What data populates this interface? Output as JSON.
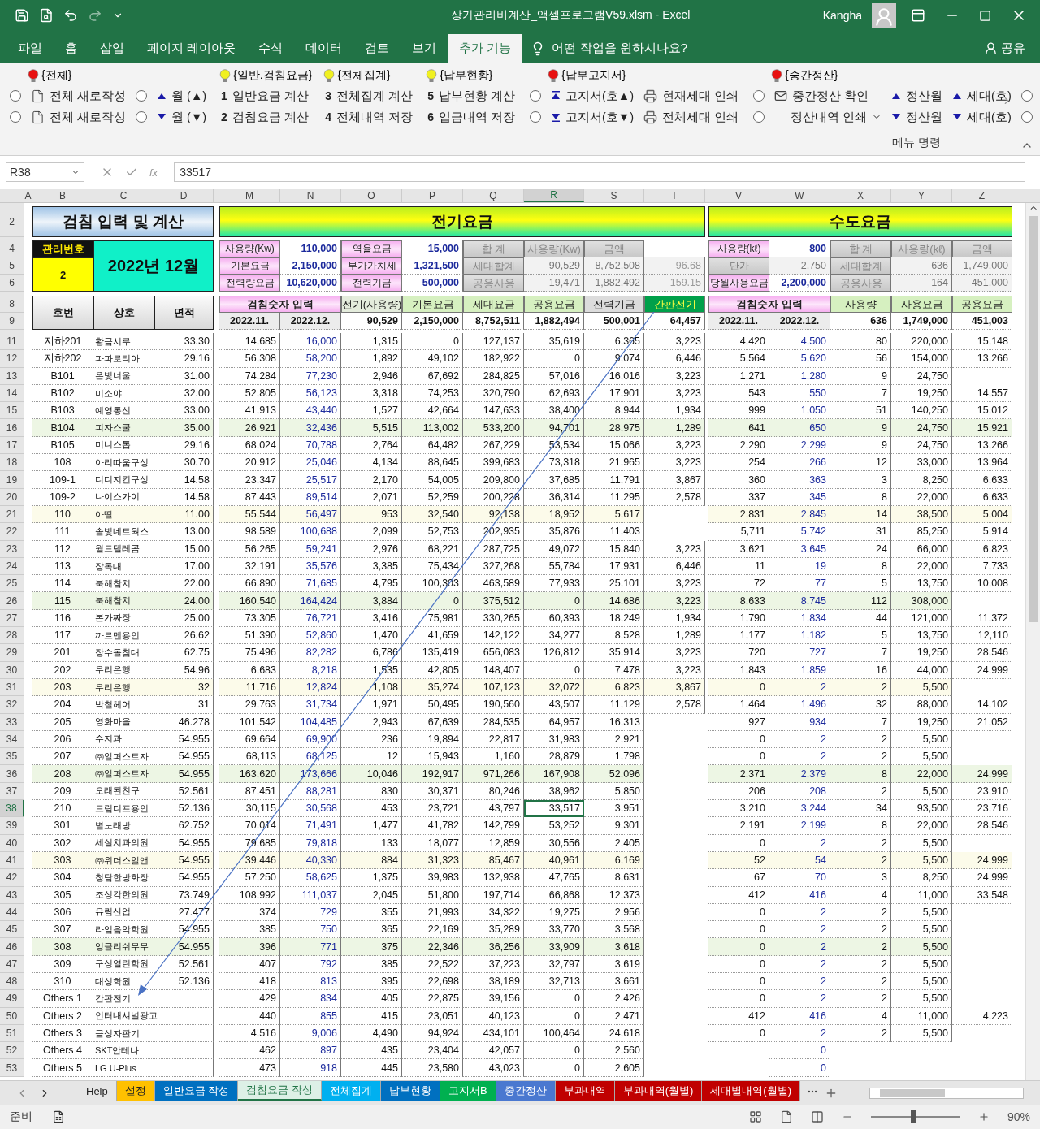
{
  "title_bar": {
    "title": "상가관리비계산_액셀프로그램V59.xlsm  -  Excel",
    "user": "Kangha"
  },
  "menu_tabs": [
    {
      "label": "파일",
      "selected": false
    },
    {
      "label": "홈",
      "selected": false
    },
    {
      "label": "삽입",
      "selected": false
    },
    {
      "label": "페이지 레이아웃",
      "selected": false
    },
    {
      "label": "수식",
      "selected": false
    },
    {
      "label": "데이터",
      "selected": false
    },
    {
      "label": "검토",
      "selected": false
    },
    {
      "label": "보기",
      "selected": false
    },
    {
      "label": "추가 기능",
      "selected": true
    }
  ],
  "tell_me": "어떤 작업을 원하시나요?",
  "share": "공유",
  "ribbon": {
    "groups": [
      {
        "header": {
          "label": "{전체}",
          "color": "#e81010"
        },
        "columns": [
          [
            {
              "kind": "radio",
              "selected": false
            },
            {
              "kind": "radio",
              "selected": false
            }
          ],
          [
            {
              "kind": "doc",
              "label": "전체 새로작성"
            },
            {
              "kind": "doc",
              "label": "전체 새로작성"
            }
          ],
          [
            {
              "kind": "radio",
              "selected": false
            },
            {
              "kind": "radio",
              "selected": false
            }
          ],
          [
            {
              "kind": "up",
              "label": "월 (▲)"
            },
            {
              "kind": "down",
              "label": "월 (▼)"
            }
          ]
        ]
      },
      {
        "header": {
          "label": "{일반.검침요금}",
          "color": "#f0f020"
        },
        "columns": [
          [
            {
              "kind": "num",
              "number": "1",
              "label": "일반요금 계산"
            },
            {
              "kind": "num",
              "number": "2",
              "label": "검침요금 계산"
            }
          ]
        ]
      },
      {
        "header": {
          "label": "{전체집계}",
          "color": "#f0f020"
        },
        "columns": [
          [
            {
              "kind": "num",
              "number": "3",
              "label": "전체집계 계산"
            },
            {
              "kind": "num",
              "number": "4",
              "label": "전체내역 저장"
            }
          ]
        ]
      },
      {
        "header": {
          "label": "{납부현황}",
          "color": "#f0f020"
        },
        "columns": [
          [
            {
              "kind": "num",
              "number": "5",
              "label": "납부현황 계산"
            },
            {
              "kind": "num",
              "number": "6",
              "label": "입금내역 저장"
            }
          ]
        ]
      },
      {
        "header": {
          "label": "{납부고지서}",
          "color": "#e81010"
        },
        "columns": [
          [
            {
              "kind": "radio",
              "selected": false
            },
            {
              "kind": "radio",
              "selected": false
            }
          ],
          [
            {
              "kind": "top",
              "label": "고지서(호▲)"
            },
            {
              "kind": "bottom",
              "label": "고지서(호▼)"
            }
          ],
          [
            {
              "kind": "print",
              "label": "현재세대 인쇄"
            },
            {
              "kind": "print",
              "label": "전체세대 인쇄"
            }
          ]
        ]
      },
      {
        "header": {
          "label": "{중간정산}",
          "color": "#e81010"
        },
        "columns": [
          [
            {
              "kind": "radio",
              "selected": false
            },
            {
              "kind": "radio",
              "selected": false
            }
          ],
          [
            {
              "kind": "mail",
              "label": "중간정산 확인"
            },
            {
              "kind": "dropdown",
              "label": "정산내역 인쇄"
            }
          ],
          [
            {
              "kind": "up",
              "label": "정산월"
            },
            {
              "kind": "down",
              "label": "정산월"
            }
          ],
          [
            {
              "kind": "up",
              "label": "세대(호)"
            },
            {
              "kind": "down",
              "label": "세대(호)"
            }
          ],
          [
            {
              "kind": "radio",
              "selected": false
            },
            {
              "kind": "radio",
              "selected": false
            }
          ]
        ]
      }
    ],
    "caption": "메뉴 명령"
  },
  "formula_bar": {
    "name_box": "R38",
    "function_label": "fx",
    "formula": "33517"
  },
  "columns": [
    {
      "label": "A",
      "selected": false
    },
    {
      "label": "B",
      "selected": false
    },
    {
      "label": "C",
      "selected": false
    },
    {
      "label": "D",
      "selected": false
    },
    {
      "label": "M",
      "selected": false
    },
    {
      "label": "N",
      "selected": false
    },
    {
      "label": "O",
      "selected": false
    },
    {
      "label": "P",
      "selected": false
    },
    {
      "label": "Q",
      "selected": false
    },
    {
      "label": "R",
      "selected": true
    },
    {
      "label": "S",
      "selected": false
    },
    {
      "label": "T",
      "selected": false
    },
    {
      "label": "V",
      "selected": false
    },
    {
      "label": "W",
      "selected": false
    },
    {
      "label": "X",
      "selected": false
    },
    {
      "label": "Y",
      "selected": false
    },
    {
      "label": "Z",
      "selected": false
    }
  ],
  "header_rows": [
    "2",
    "4",
    "5",
    "6",
    "8",
    "9"
  ],
  "left_panel": {
    "title": "검침 입력 및 계산",
    "mgmt_label": "관리번호",
    "mgmt_no": "2",
    "period": "2022년 12월",
    "columns": [
      "호번",
      "상호",
      "면적"
    ]
  },
  "electric": {
    "title": "전기요금",
    "inputs": [
      {
        "label": "사용량(Kw)",
        "value": "110,000",
        "kind": "input"
      },
      {
        "label": "기본요금",
        "value": "2,150,000",
        "kind": "input"
      },
      {
        "label": "전력량요금",
        "value": "10,620,000",
        "kind": "input"
      }
    ],
    "inputs2": [
      {
        "label": "역율요금",
        "value": "15,000",
        "kind": "input"
      },
      {
        "label": "부가가치세",
        "value": "1,321,500",
        "kind": "input"
      },
      {
        "label": "전력기금",
        "value": "500,000",
        "kind": "input"
      }
    ],
    "summary_headers": [
      "합  계",
      "사용량(Kw)",
      "금액"
    ],
    "summary_rows": [
      {
        "label": "세대합계",
        "usage": "90,529",
        "amount": "8,752,508",
        "ratio": "96.68"
      },
      {
        "label": "공용사용",
        "usage": "19,471",
        "amount": "1,882,492",
        "ratio": "159.15"
      }
    ],
    "reading_header": "검침숫자 입력",
    "months": [
      "2022.11.",
      "2022.12."
    ],
    "columns": [
      {
        "label": "전기(사용량)",
        "color": "#e4ecdc"
      },
      {
        "label": "기본요금",
        "color": "#d6f0c0"
      },
      {
        "label": "세대요금",
        "color": "#d6f0c0"
      },
      {
        "label": "공용요금",
        "color": "#d6f0c0"
      },
      {
        "label": "전력기금",
        "color": "#dcdcdc"
      },
      {
        "label": "간판전기",
        "color": "#00a04a"
      }
    ],
    "totals": [
      "90,529",
      "2,150,000",
      "8,752,511",
      "1,882,494",
      "500,001",
      "64,457"
    ]
  },
  "water": {
    "title": "수도요금",
    "inputs": [
      {
        "label": "사용량(kℓ)",
        "value": "800",
        "kind": "input"
      },
      {
        "label": "단가",
        "value": "2,750",
        "kind": "computed"
      },
      {
        "label": "당월사용요금",
        "value": "2,200,000",
        "kind": "input"
      }
    ],
    "summary_headers": [
      "합  계",
      "사용량(kℓ)",
      "금액"
    ],
    "summary_rows": [
      {
        "label": "세대합계",
        "usage": "636",
        "amount": "1,749,000"
      },
      {
        "label": "공용사용",
        "usage": "164",
        "amount": "451,000"
      }
    ],
    "reading_header": "검침숫자 입력",
    "months": [
      "2022.11.",
      "2022.12."
    ],
    "columns": [
      {
        "label": "사용량",
        "color": "#d6f0c0"
      },
      {
        "label": "사용요금",
        "color": "#d6f0c0"
      },
      {
        "label": "공용요금",
        "color": "#d6f0c0"
      }
    ],
    "totals": [
      "636",
      "1,749,000",
      "451,003"
    ]
  },
  "rows": [
    {
      "row": "11",
      "selected": false,
      "cells": [
        "지하201",
        "황금시루",
        "33.30",
        "14,685",
        "16,000",
        "1,315",
        "0",
        "127,137",
        "35,619",
        "6,365",
        "3,223",
        "4,420",
        "4,500",
        "80",
        "220,000",
        "15,148"
      ]
    },
    {
      "row": "12",
      "selected": false,
      "cells": [
        "지하202",
        "파파로티아",
        "29.16",
        "56,308",
        "58,200",
        "1,892",
        "49,102",
        "182,922",
        "0",
        "9,074",
        "6,446",
        "5,564",
        "5,620",
        "56",
        "154,000",
        "13,266"
      ]
    },
    {
      "row": "13",
      "selected": false,
      "cells": [
        "B101",
        "은빛너울",
        "31.00",
        "74,284",
        "77,230",
        "2,946",
        "67,692",
        "284,825",
        "57,016",
        "16,016",
        "3,223",
        "1,271",
        "1,280",
        "9",
        "24,750",
        null
      ]
    },
    {
      "row": "14",
      "selected": false,
      "cells": [
        "B102",
        "미소야",
        "32.00",
        "52,805",
        "56,123",
        "3,318",
        "74,253",
        "320,790",
        "62,693",
        "17,901",
        "3,223",
        "543",
        "550",
        "7",
        "19,250",
        "14,557"
      ]
    },
    {
      "row": "15",
      "selected": false,
      "cells": [
        "B103",
        "예영통신",
        "33.00",
        "41,913",
        "43,440",
        "1,527",
        "42,664",
        "147,633",
        "38,400",
        "8,944",
        "1,934",
        "999",
        "1,050",
        "51",
        "140,250",
        "15,012"
      ]
    },
    {
      "row": "16",
      "selected": false,
      "color": "#edf6e4",
      "cells": [
        "B104",
        "피자스쿨",
        "35.00",
        "26,921",
        "32,436",
        "5,515",
        "113,002",
        "533,200",
        "94,701",
        "28,975",
        "1,289",
        "641",
        "650",
        "9",
        "24,750",
        "15,921"
      ]
    },
    {
      "row": "17",
      "selected": false,
      "cells": [
        "B105",
        "미니스톱",
        "29.16",
        "68,024",
        "70,788",
        "2,764",
        "64,482",
        "267,229",
        "53,534",
        "15,066",
        "3,223",
        "2,290",
        "2,299",
        "9",
        "24,750",
        "13,266"
      ]
    },
    {
      "row": "18",
      "selected": false,
      "cells": [
        "108",
        "아리따움구성",
        "30.70",
        "20,912",
        "25,046",
        "4,134",
        "88,645",
        "399,683",
        "73,318",
        "21,965",
        "3,223",
        "254",
        "266",
        "12",
        "33,000",
        "13,964"
      ]
    },
    {
      "row": "19",
      "selected": false,
      "cells": [
        "109-1",
        "디디지킨구성",
        "14.58",
        "23,347",
        "25,517",
        "2,170",
        "54,005",
        "209,800",
        "37,685",
        "11,791",
        "3,867",
        "360",
        "363",
        "3",
        "8,250",
        "6,633"
      ]
    },
    {
      "row": "20",
      "selected": false,
      "cells": [
        "109-2",
        "나이스가이",
        "14.58",
        "87,443",
        "89,514",
        "2,071",
        "52,259",
        "200,228",
        "36,314",
        "11,295",
        "2,578",
        "337",
        "345",
        "8",
        "22,000",
        "6,633"
      ]
    },
    {
      "row": "21",
      "selected": false,
      "color": "#fcfbea",
      "cells": [
        "110",
        "아딸",
        "11.00",
        "55,544",
        "56,497",
        "953",
        "32,540",
        "92,138",
        "18,952",
        "5,617",
        null,
        "2,831",
        "2,845",
        "14",
        "38,500",
        "5,004"
      ]
    },
    {
      "row": "22",
      "selected": false,
      "cells": [
        "111",
        "솔빛네트웍스",
        "13.00",
        "98,589",
        "100,688",
        "2,099",
        "52,753",
        "202,935",
        "35,876",
        "11,403",
        null,
        "5,711",
        "5,742",
        "31",
        "85,250",
        "5,914"
      ]
    },
    {
      "row": "23",
      "selected": false,
      "cells": [
        "112",
        "월드텔레콤",
        "15.00",
        "56,265",
        "59,241",
        "2,976",
        "68,221",
        "287,725",
        "49,072",
        "15,840",
        "3,223",
        "3,621",
        "3,645",
        "24",
        "66,000",
        "6,823"
      ]
    },
    {
      "row": "24",
      "selected": false,
      "cells": [
        "113",
        "장독대",
        "17.00",
        "32,191",
        "35,576",
        "3,385",
        "75,434",
        "327,268",
        "55,784",
        "17,931",
        "6,446",
        "11",
        "19",
        "8",
        "22,000",
        "7,733"
      ]
    },
    {
      "row": "25",
      "selected": false,
      "cells": [
        "114",
        "북해참치",
        "22.00",
        "66,890",
        "71,685",
        "4,795",
        "100,303",
        "463,589",
        "77,933",
        "25,101",
        "3,223",
        "72",
        "77",
        "5",
        "13,750",
        "10,008"
      ]
    },
    {
      "row": "26",
      "selected": false,
      "color": "#edf6e4",
      "cells": [
        "115",
        "북해참치",
        "24.00",
        "160,540",
        "164,424",
        "3,884",
        "0",
        "375,512",
        "0",
        "14,686",
        "3,223",
        "8,633",
        "8,745",
        "112",
        "308,000",
        null
      ]
    },
    {
      "row": "27",
      "selected": false,
      "cells": [
        "116",
        "본가짜장",
        "25.00",
        "73,305",
        "76,721",
        "3,416",
        "75,981",
        "330,265",
        "60,393",
        "18,249",
        "1,934",
        "1,790",
        "1,834",
        "44",
        "121,000",
        "11,372"
      ]
    },
    {
      "row": "28",
      "selected": false,
      "cells": [
        "117",
        "까르멘용인",
        "26.62",
        "51,390",
        "52,860",
        "1,470",
        "41,659",
        "142,122",
        "34,277",
        "8,528",
        "1,289",
        "1,177",
        "1,182",
        "5",
        "13,750",
        "12,110"
      ]
    },
    {
      "row": "29",
      "selected": false,
      "cells": [
        "201",
        "장수돌침대",
        "62.75",
        "75,496",
        "82,282",
        "6,786",
        "135,419",
        "656,083",
        "126,812",
        "35,914",
        "3,223",
        "720",
        "727",
        "7",
        "19,250",
        "28,546"
      ]
    },
    {
      "row": "30",
      "selected": false,
      "cells": [
        "202",
        "우리은행",
        "54.96",
        "6,683",
        "8,218",
        "1,535",
        "42,805",
        "148,407",
        "0",
        "7,478",
        "3,223",
        "1,843",
        "1,859",
        "16",
        "44,000",
        "24,999"
      ]
    },
    {
      "row": "31",
      "selected": false,
      "color": "#fcfbea",
      "cells": [
        "203",
        "우리은행",
        "32",
        "11,716",
        "12,824",
        "1,108",
        "35,274",
        "107,123",
        "32,072",
        "6,823",
        "3,867",
        "0",
        "2",
        "2",
        "5,500",
        null
      ]
    },
    {
      "row": "32",
      "selected": false,
      "cells": [
        "204",
        "박철헤어",
        "31",
        "29,763",
        "31,734",
        "1,971",
        "50,495",
        "190,560",
        "43,507",
        "11,129",
        "2,578",
        "1,464",
        "1,496",
        "32",
        "88,000",
        "14,102"
      ]
    },
    {
      "row": "33",
      "selected": false,
      "cells": [
        "205",
        "영화마을",
        "46.278",
        "101,542",
        "104,485",
        "2,943",
        "67,639",
        "284,535",
        "64,957",
        "16,313",
        null,
        "927",
        "934",
        "7",
        "19,250",
        "21,052"
      ]
    },
    {
      "row": "34",
      "selected": false,
      "cells": [
        "206",
        "수지과",
        "54.955",
        "69,664",
        "69,900",
        "236",
        "19,894",
        "22,817",
        "31,983",
        "2,921",
        null,
        "0",
        "2",
        "2",
        "5,500",
        null
      ]
    },
    {
      "row": "35",
      "selected": false,
      "cells": [
        "207",
        "㈜알퍼스트자",
        "54.955",
        "68,113",
        "68,125",
        "12",
        "15,943",
        "1,160",
        "28,879",
        "1,798",
        null,
        "0",
        "2",
        "2",
        "5,500",
        null
      ]
    },
    {
      "row": "36",
      "selected": false,
      "color": "#edf6e4",
      "cells": [
        "208",
        "㈜알퍼스트자",
        "54.955",
        "163,620",
        "173,666",
        "10,046",
        "192,917",
        "971,266",
        "167,908",
        "52,096",
        null,
        "2,371",
        "2,379",
        "8",
        "22,000",
        "24,999"
      ]
    },
    {
      "row": "37",
      "selected": false,
      "cells": [
        "209",
        "오래된친구",
        "52.561",
        "87,451",
        "88,281",
        "830",
        "30,371",
        "80,246",
        "38,962",
        "5,850",
        null,
        "206",
        "208",
        "2",
        "5,500",
        "23,910"
      ]
    },
    {
      "row": "38",
      "selected": true,
      "cells": [
        "210",
        "드림디프용인",
        "52.136",
        "30,115",
        "30,568",
        "453",
        "23,721",
        "43,797",
        "33,517",
        "3,951",
        null,
        "3,210",
        "3,244",
        "34",
        "93,500",
        "23,716"
      ]
    },
    {
      "row": "39",
      "selected": false,
      "cells": [
        "301",
        "별노래방",
        "62.752",
        "70,014",
        "71,491",
        "1,477",
        "41,782",
        "142,799",
        "53,252",
        "9,301",
        null,
        "2,191",
        "2,199",
        "8",
        "22,000",
        "28,546"
      ]
    },
    {
      "row": "40",
      "selected": false,
      "cells": [
        "302",
        "세실치과의원",
        "54.955",
        "79,685",
        "79,818",
        "133",
        "18,077",
        "12,859",
        "30,556",
        "2,405",
        null,
        "0",
        "2",
        "2",
        "5,500",
        null
      ]
    },
    {
      "row": "41",
      "selected": false,
      "color": "#fcfbea",
      "cells": [
        "303",
        "㈜위더스알앤",
        "54.955",
        "39,446",
        "40,330",
        "884",
        "31,323",
        "85,467",
        "40,961",
        "6,169",
        null,
        "52",
        "54",
        "2",
        "5,500",
        "24,999"
      ]
    },
    {
      "row": "42",
      "selected": false,
      "cells": [
        "304",
        "청담한방화장",
        "54.955",
        "57,250",
        "58,625",
        "1,375",
        "39,983",
        "132,938",
        "47,765",
        "8,631",
        null,
        "67",
        "70",
        "3",
        "8,250",
        "24,999"
      ]
    },
    {
      "row": "43",
      "selected": false,
      "cells": [
        "305",
        "조성각한의원",
        "73.749",
        "108,992",
        "111,037",
        "2,045",
        "51,800",
        "197,714",
        "66,868",
        "12,373",
        null,
        "412",
        "416",
        "4",
        "11,000",
        "33,548"
      ]
    },
    {
      "row": "44",
      "selected": false,
      "cells": [
        "306",
        "유림산업",
        "27.477",
        "374",
        "729",
        "355",
        "21,993",
        "34,322",
        "19,275",
        "2,956",
        null,
        "0",
        "2",
        "2",
        "5,500",
        null
      ]
    },
    {
      "row": "45",
      "selected": false,
      "cells": [
        "307",
        "라임음악학원",
        "54.955",
        "385",
        "750",
        "365",
        "22,169",
        "35,289",
        "33,770",
        "3,568",
        null,
        "0",
        "2",
        "2",
        "5,500",
        null
      ]
    },
    {
      "row": "46",
      "selected": false,
      "color": "#edf6e4",
      "cells": [
        "308",
        "잉글리쉬무무",
        "54.955",
        "396",
        "771",
        "375",
        "22,346",
        "36,256",
        "33,909",
        "3,618",
        null,
        "0",
        "2",
        "2",
        "5,500",
        null
      ]
    },
    {
      "row": "47",
      "selected": false,
      "cells": [
        "309",
        "구성열린학원",
        "52.561",
        "407",
        "792",
        "385",
        "22,522",
        "37,223",
        "32,797",
        "3,619",
        null,
        "0",
        "2",
        "2",
        "5,500",
        null
      ]
    },
    {
      "row": "48",
      "selected": false,
      "cells": [
        "310",
        "대성학원",
        "52.136",
        "418",
        "813",
        "395",
        "22,698",
        "38,189",
        "32,713",
        "3,661",
        null,
        "0",
        "2",
        "2",
        "5,500",
        null
      ]
    },
    {
      "row": "49",
      "selected": false,
      "cells": [
        "Others 1",
        "간판전기",
        null,
        "429",
        "834",
        "405",
        "22,875",
        "39,156",
        "0",
        "2,426",
        null,
        "0",
        "2",
        "2",
        "5,500",
        null
      ]
    },
    {
      "row": "50",
      "selected": false,
      "cells": [
        "Others 2",
        "인터내셔널광고",
        null,
        "440",
        "855",
        "415",
        "23,051",
        "40,123",
        "0",
        "2,471",
        null,
        "412",
        "416",
        "4",
        "11,000",
        "4,223"
      ]
    },
    {
      "row": "51",
      "selected": false,
      "cells": [
        "Others 3",
        "금성자판기",
        null,
        "4,516",
        "9,006",
        "4,490",
        "94,924",
        "434,101",
        "100,464",
        "24,618",
        null,
        "0",
        "2",
        "2",
        "5,500",
        null
      ]
    },
    {
      "row": "52",
      "selected": false,
      "cells": [
        "Others 4",
        "SKT안테나",
        null,
        "462",
        "897",
        "435",
        "23,404",
        "42,057",
        "0",
        "2,560",
        null,
        null,
        "0",
        null,
        null,
        null
      ]
    },
    {
      "row": "53",
      "selected": false,
      "cells": [
        "Others 5",
        "LG U-Plus",
        null,
        "473",
        "918",
        "445",
        "23,580",
        "43,023",
        "0",
        "2,605",
        null,
        null,
        "0",
        null,
        null,
        null
      ]
    }
  ],
  "sheet_tabs": [
    {
      "label": "Help",
      "color": "#e6e6e6",
      "selected": false
    },
    {
      "label": "설정",
      "color": "#ffc000",
      "selected": false
    },
    {
      "label": "일반요금 작성",
      "color": "#0070c0",
      "selected": false
    },
    {
      "label": "검침요금 작성",
      "color": "#ddf0e6",
      "selected": true
    },
    {
      "label": "전체집계",
      "color": "#00b0f0",
      "selected": false
    },
    {
      "label": "납부현황",
      "color": "#0070c0",
      "selected": false
    },
    {
      "label": "고지서B",
      "color": "#00b050",
      "selected": false
    },
    {
      "label": "중간정산",
      "color": "#4a78d0",
      "selected": false
    },
    {
      "label": "부과내역",
      "color": "#c00000",
      "selected": false
    },
    {
      "label": "부과내역(월별)",
      "color": "#c00000",
      "selected": false
    },
    {
      "label": "세대별내역(월별)",
      "color": "#c00000",
      "selected": false
    }
  ],
  "status": {
    "text": "준비",
    "zoom": "90%",
    "zoom_slider": {
      "level": 0.47
    }
  }
}
